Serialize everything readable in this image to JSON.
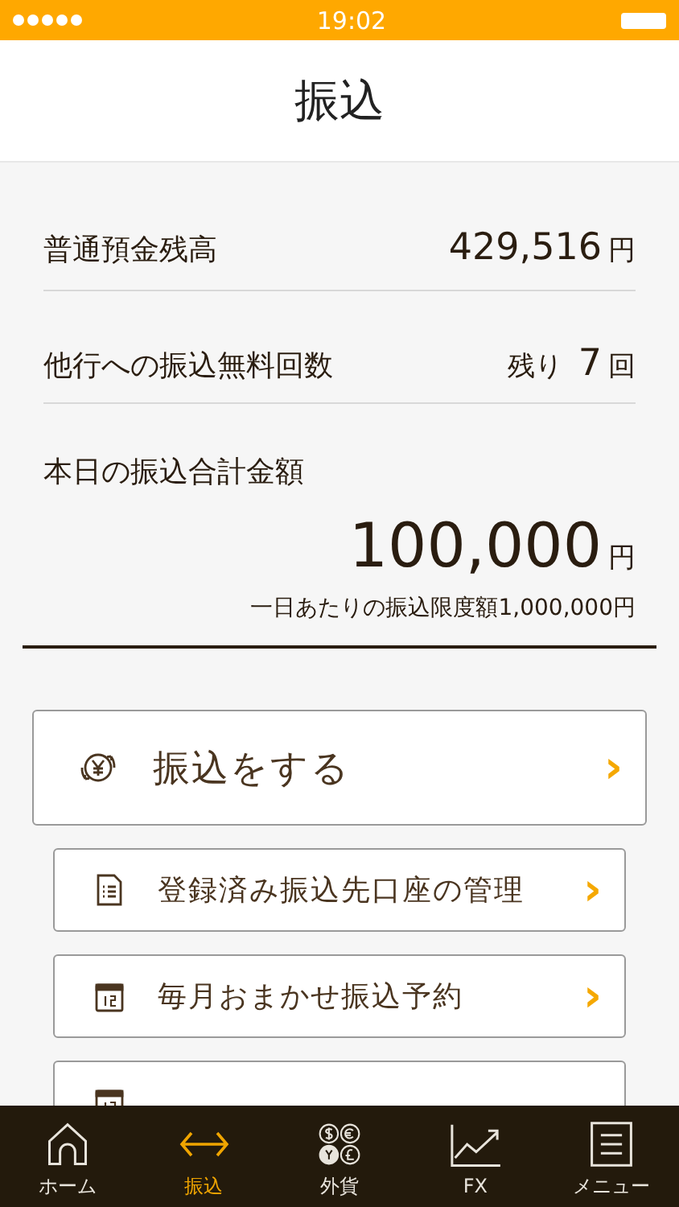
{
  "status_bar": {
    "time": "19:02"
  },
  "header": {
    "title": "振込"
  },
  "summary": [
    {
      "label": "普通預金残高",
      "value": "429,516",
      "unit": "円"
    },
    {
      "label": "他行への振込無料回数",
      "prefix": "残り",
      "value": "7",
      "unit": "回"
    }
  ],
  "today": {
    "label": "本日の振込合計金額",
    "value": "100,000",
    "unit": "円",
    "limit_note": "一日あたりの振込限度額1,000,000円"
  },
  "menu": [
    {
      "kind": "primary",
      "label": "振込をする",
      "chevron": "›"
    },
    {
      "kind": "secondary",
      "label": "登録済み振込先口座の管理",
      "chevron": "›"
    },
    {
      "kind": "secondary",
      "label": "毎月おまかせ振込予約",
      "chevron": "›"
    },
    {
      "kind": "secondary"
    }
  ],
  "tab_bar": [
    {
      "label": "ホーム",
      "selected": false
    },
    {
      "label": "振込",
      "selected": true
    },
    {
      "label": "外貨",
      "selected": false
    },
    {
      "label": "FX",
      "selected": false
    },
    {
      "label": "メニュー",
      "selected": false
    }
  ]
}
